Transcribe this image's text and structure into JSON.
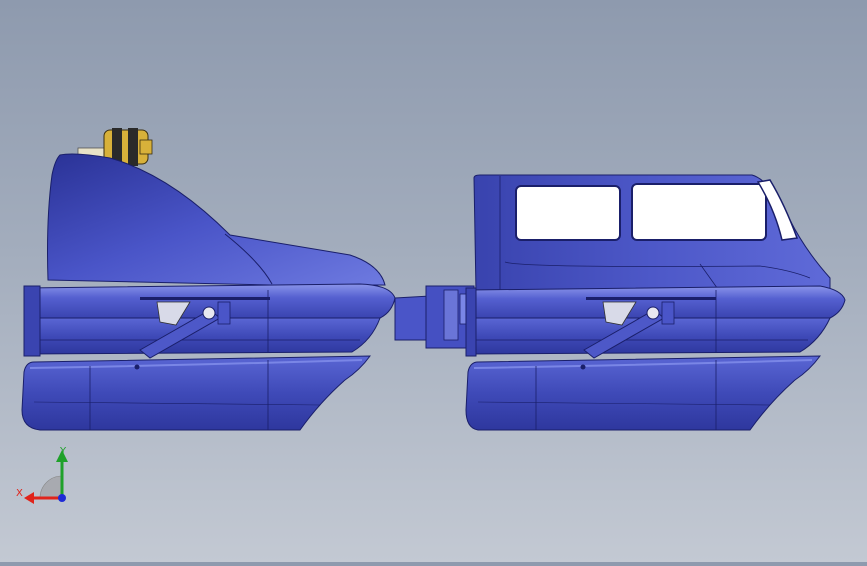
{
  "viewport": {
    "background_top": "#8e9aae",
    "background_bottom": "#c3c9d3"
  },
  "model": {
    "body_color": "#4a55c8",
    "body_dark": "#2a3296",
    "body_light": "#7a86e6",
    "window_color": "#ffffff",
    "winch_color": "#d8b13a",
    "components": [
      "hull-module-left",
      "hull-module-right",
      "coupler",
      "cabin",
      "winch",
      "fairing"
    ]
  },
  "triad": {
    "x_label": "X",
    "y_label": "Y",
    "x_color": "#e0241b",
    "y_color": "#1fa12a",
    "z_color": "#1f2bd6"
  }
}
